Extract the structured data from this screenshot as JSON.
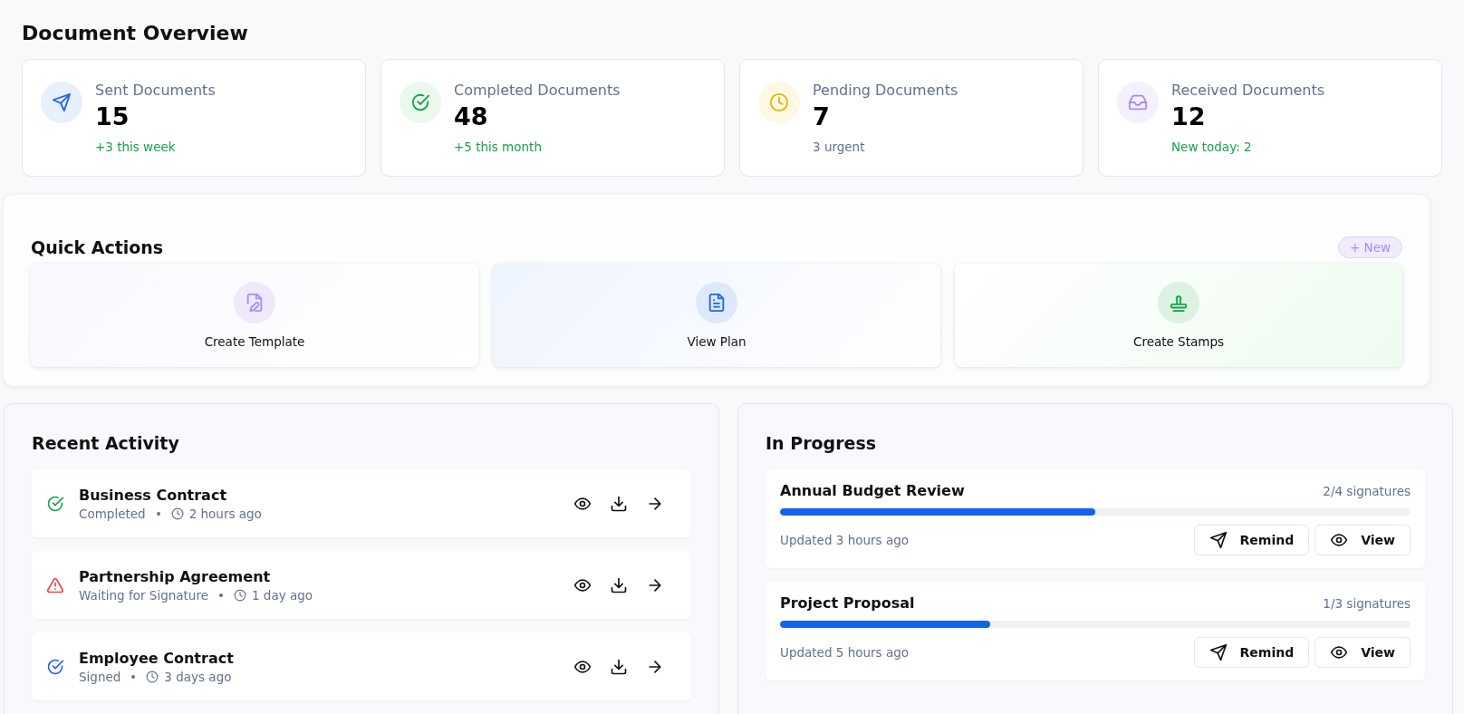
{
  "overview": {
    "title": "Document Overview",
    "stats": [
      {
        "kind": "send",
        "label": "Sent Documents",
        "value": "15",
        "note": "+3 this week",
        "positive": true
      },
      {
        "kind": "check",
        "label": "Completed Documents",
        "value": "48",
        "note": "+5 this month",
        "positive": true
      },
      {
        "kind": "clock",
        "label": "Pending Documents",
        "value": "7",
        "note": "3 urgent",
        "positive": false
      },
      {
        "kind": "inbox",
        "label": "Received Documents",
        "value": "12",
        "note": "New today: 2",
        "positive": true
      }
    ]
  },
  "quick_actions": {
    "title": "Quick Actions",
    "new_button": "+ New",
    "actions": [
      {
        "kind": "template",
        "label": "Create Template"
      },
      {
        "kind": "plan",
        "label": "View Plan"
      },
      {
        "kind": "stamp",
        "label": "Create Stamps"
      }
    ]
  },
  "recent_activity": {
    "title": "Recent Activity",
    "items": [
      {
        "kind": "completed",
        "name": "Business Contract",
        "state": "Completed",
        "time": "2 hours ago"
      },
      {
        "kind": "warning",
        "name": "Partnership Agreement",
        "state": "Waiting for Signature",
        "time": "1 day ago"
      },
      {
        "kind": "signed",
        "name": "Employee Contract",
        "state": "Signed",
        "time": "3 days ago"
      }
    ]
  },
  "in_progress": {
    "title": "In Progress",
    "items": [
      {
        "name": "Annual Budget Review",
        "signatures": "2/4 signatures",
        "level": 0.5,
        "updated": "Updated 3 hours ago",
        "remind": "Remind",
        "view": "View"
      },
      {
        "name": "Project Proposal",
        "signatures": "1/3 signatures",
        "level": 0.333,
        "updated": "Updated 5 hours ago",
        "remind": "Remind",
        "view": "View"
      }
    ]
  }
}
